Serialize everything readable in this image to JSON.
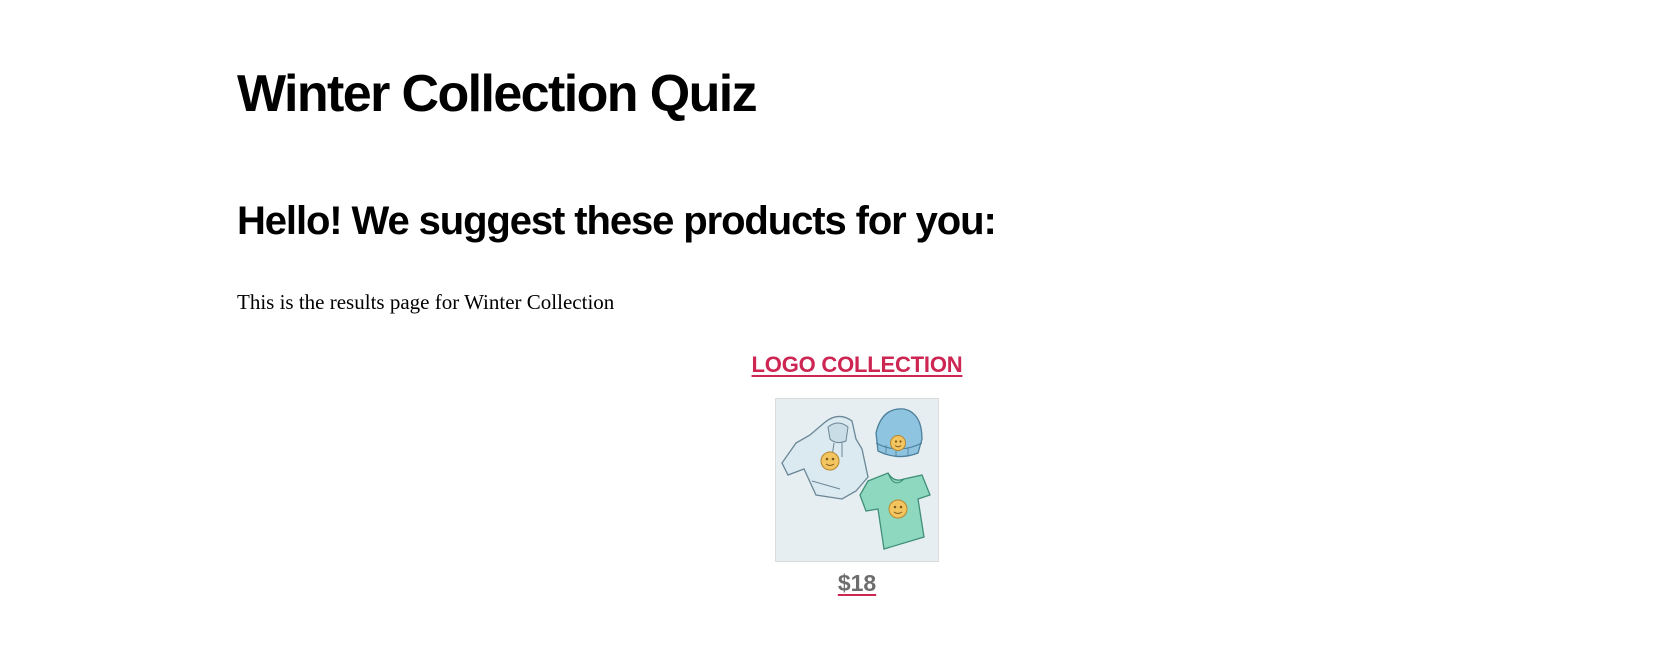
{
  "page": {
    "title": "Winter Collection Quiz",
    "results_heading": "Hello! We suggest these products for you:",
    "results_text": "This is the results page for Winter Collection"
  },
  "product": {
    "name": "LOGO COLLECTION",
    "price": "$18",
    "image_icon": "clothing-collection-illustration",
    "image_items": [
      "hoodie",
      "beanie",
      "t-shirt"
    ]
  },
  "colors": {
    "accent": "#cd2653",
    "text": "#000000",
    "price_text": "#6d6d6d",
    "image_background": "#e6eef1",
    "hoodie": "#dbe9f0",
    "beanie": "#8fc4e0",
    "tshirt": "#8fd8c0",
    "badge": "#f3c561"
  }
}
